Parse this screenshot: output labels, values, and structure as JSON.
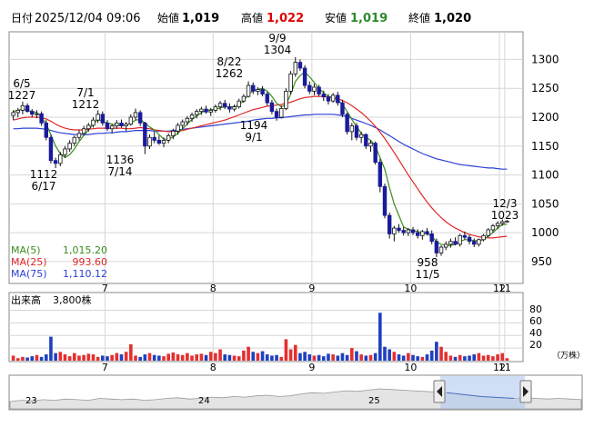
{
  "header": {
    "label_date": "日付",
    "date": "2025/12/04 09:06",
    "label_open": "始値",
    "open": "1,019",
    "label_high": "高値",
    "high": "1,022",
    "label_low": "安値",
    "low": "1,019",
    "label_close": "終値",
    "close": "1,020"
  },
  "colors": {
    "up": "#ffffff",
    "down": "#1a1a9c",
    "ma5": "#3c8c1e",
    "ma25": "#e22828",
    "ma75": "#2c3fd8",
    "high_value": "#e00000",
    "low_value": "#2a8a2a",
    "vol_bar": "#e43030",
    "vol_bar_down": "#2040c0",
    "nav_fill": "#a9c4ee",
    "frame": "#888888"
  },
  "legend": {
    "ma5_label": "MA(5)",
    "ma5_value": "1,015.20",
    "ma25_label": "MA(25)",
    "ma25_value": "993.60",
    "ma75_label": "MA(75)",
    "ma75_value": "1,110.12"
  },
  "volume_panel": {
    "label": "出来高",
    "value": "3,800株",
    "unit": "（万株）",
    "ticks": [
      "80",
      "60",
      "40",
      "20"
    ]
  },
  "navigator": {
    "year_labels": [
      "23",
      "24",
      "25"
    ]
  },
  "chart_data": {
    "type": "candlestick",
    "x_labels": [
      "7",
      "8",
      "9",
      "10",
      "11",
      "12"
    ],
    "y_ticks": [
      1300,
      1250,
      1200,
      1150,
      1100,
      1050,
      1000,
      950
    ],
    "ylim": [
      920,
      1340
    ],
    "annotations": [
      {
        "date": "6/5",
        "value": "1227"
      },
      {
        "date": "7/1",
        "value": "1212"
      },
      {
        "date": "6/17",
        "value": "1112"
      },
      {
        "date": "7/14",
        "value": "1136"
      },
      {
        "date": "8/22",
        "value": "1262"
      },
      {
        "date": "9/9",
        "value": "1304"
      },
      {
        "date": "9/1",
        "value": "1194"
      },
      {
        "date": "11/5",
        "value": "958"
      },
      {
        "date": "12/3",
        "value": "1023"
      }
    ],
    "candles": [
      [
        1203,
        1212,
        1195,
        1208
      ],
      [
        1208,
        1216,
        1200,
        1212
      ],
      [
        1212,
        1227,
        1205,
        1220
      ],
      [
        1220,
        1224,
        1208,
        1210
      ],
      [
        1210,
        1214,
        1200,
        1205
      ],
      [
        1205,
        1212,
        1198,
        1206
      ],
      [
        1206,
        1210,
        1185,
        1190
      ],
      [
        1190,
        1195,
        1160,
        1165
      ],
      [
        1165,
        1170,
        1120,
        1125
      ],
      [
        1125,
        1130,
        1112,
        1120
      ],
      [
        1120,
        1140,
        1115,
        1135
      ],
      [
        1135,
        1150,
        1130,
        1145
      ],
      [
        1145,
        1160,
        1140,
        1155
      ],
      [
        1155,
        1168,
        1150,
        1165
      ],
      [
        1165,
        1178,
        1160,
        1172
      ],
      [
        1172,
        1185,
        1168,
        1180
      ],
      [
        1180,
        1190,
        1175,
        1186
      ],
      [
        1186,
        1200,
        1182,
        1195
      ],
      [
        1195,
        1212,
        1190,
        1205
      ],
      [
        1205,
        1210,
        1185,
        1190
      ],
      [
        1190,
        1195,
        1176,
        1180
      ],
      [
        1180,
        1188,
        1172,
        1185
      ],
      [
        1185,
        1195,
        1180,
        1190
      ],
      [
        1190,
        1196,
        1182,
        1185
      ],
      [
        1185,
        1192,
        1176,
        1188
      ],
      [
        1188,
        1205,
        1185,
        1200
      ],
      [
        1200,
        1215,
        1195,
        1208
      ],
      [
        1208,
        1212,
        1185,
        1190
      ],
      [
        1190,
        1192,
        1136,
        1150
      ],
      [
        1150,
        1170,
        1145,
        1165
      ],
      [
        1165,
        1175,
        1155,
        1160
      ],
      [
        1160,
        1168,
        1152,
        1155
      ],
      [
        1155,
        1165,
        1148,
        1160
      ],
      [
        1160,
        1172,
        1155,
        1168
      ],
      [
        1168,
        1180,
        1162,
        1176
      ],
      [
        1176,
        1190,
        1170,
        1186
      ],
      [
        1186,
        1196,
        1180,
        1192
      ],
      [
        1192,
        1202,
        1186,
        1198
      ],
      [
        1198,
        1208,
        1192,
        1204
      ],
      [
        1204,
        1214,
        1198,
        1210
      ],
      [
        1210,
        1218,
        1204,
        1214
      ],
      [
        1214,
        1220,
        1206,
        1209
      ],
      [
        1209,
        1216,
        1202,
        1212
      ],
      [
        1212,
        1222,
        1208,
        1218
      ],
      [
        1218,
        1228,
        1212,
        1224
      ],
      [
        1224,
        1230,
        1214,
        1218
      ],
      [
        1218,
        1224,
        1208,
        1214
      ],
      [
        1214,
        1222,
        1210,
        1218
      ],
      [
        1218,
        1232,
        1215,
        1228
      ],
      [
        1228,
        1240,
        1225,
        1236
      ],
      [
        1236,
        1262,
        1234,
        1255
      ],
      [
        1255,
        1260,
        1240,
        1245
      ],
      [
        1245,
        1252,
        1238,
        1248
      ],
      [
        1248,
        1254,
        1236,
        1240
      ],
      [
        1240,
        1244,
        1220,
        1225
      ],
      [
        1225,
        1230,
        1205,
        1210
      ],
      [
        1210,
        1215,
        1194,
        1200
      ],
      [
        1200,
        1220,
        1198,
        1215
      ],
      [
        1215,
        1250,
        1212,
        1245
      ],
      [
        1245,
        1280,
        1240,
        1275
      ],
      [
        1275,
        1304,
        1270,
        1295
      ],
      [
        1295,
        1300,
        1280,
        1285
      ],
      [
        1285,
        1290,
        1250,
        1255
      ],
      [
        1255,
        1262,
        1240,
        1245
      ],
      [
        1245,
        1258,
        1238,
        1252
      ],
      [
        1252,
        1256,
        1236,
        1240
      ],
      [
        1240,
        1246,
        1228,
        1235
      ],
      [
        1235,
        1240,
        1222,
        1228
      ],
      [
        1228,
        1242,
        1225,
        1238
      ],
      [
        1238,
        1244,
        1220,
        1225
      ],
      [
        1225,
        1230,
        1200,
        1205
      ],
      [
        1205,
        1208,
        1170,
        1175
      ],
      [
        1175,
        1190,
        1160,
        1185
      ],
      [
        1185,
        1190,
        1160,
        1165
      ],
      [
        1165,
        1175,
        1155,
        1170
      ],
      [
        1170,
        1172,
        1145,
        1150
      ],
      [
        1150,
        1160,
        1140,
        1155
      ],
      [
        1155,
        1158,
        1118,
        1122
      ],
      [
        1122,
        1128,
        1070,
        1080
      ],
      [
        1080,
        1085,
        1025,
        1030
      ],
      [
        1030,
        1035,
        990,
        998
      ],
      [
        998,
        1012,
        985,
        1008
      ],
      [
        1008,
        1015,
        1000,
        1004
      ],
      [
        1004,
        1010,
        995,
        1000
      ],
      [
        1000,
        1008,
        994,
        1005
      ],
      [
        1005,
        1010,
        996,
        1000
      ],
      [
        1000,
        1006,
        990,
        995
      ],
      [
        995,
        1005,
        988,
        1002
      ],
      [
        1002,
        1008,
        995,
        998
      ],
      [
        998,
        1004,
        980,
        985
      ],
      [
        985,
        990,
        958,
        965
      ],
      [
        965,
        978,
        960,
        975
      ],
      [
        975,
        985,
        970,
        980
      ],
      [
        980,
        990,
        974,
        985
      ],
      [
        985,
        992,
        978,
        980
      ],
      [
        980,
        998,
        976,
        995
      ],
      [
        995,
        1002,
        988,
        992
      ],
      [
        992,
        996,
        980,
        985
      ],
      [
        985,
        990,
        975,
        980
      ],
      [
        980,
        990,
        976,
        988
      ],
      [
        988,
        998,
        985,
        995
      ],
      [
        995,
        1008,
        992,
        1005
      ],
      [
        1005,
        1015,
        1000,
        1012
      ],
      [
        1012,
        1020,
        1006,
        1016
      ],
      [
        1016,
        1023,
        1012,
        1019
      ],
      [
        1019,
        1022,
        1019,
        1020
      ]
    ],
    "volumes": [
      8,
      4,
      6,
      5,
      7,
      9,
      6,
      10,
      38,
      12,
      14,
      10,
      7,
      12,
      8,
      9,
      11,
      10,
      6,
      8,
      7,
      9,
      12,
      10,
      14,
      26,
      8,
      6,
      10,
      12,
      9,
      8,
      7,
      11,
      13,
      10,
      9,
      12,
      8,
      10,
      11,
      9,
      14,
      12,
      18,
      10,
      9,
      8,
      7,
      16,
      22,
      14,
      12,
      15,
      10,
      8,
      9,
      6,
      34,
      18,
      25,
      12,
      14,
      10,
      8,
      9,
      7,
      11,
      10,
      8,
      12,
      9,
      20,
      15,
      10,
      8,
      9,
      12,
      76,
      22,
      18,
      14,
      10,
      8,
      12,
      9,
      7,
      6,
      10,
      16,
      30,
      22,
      14,
      8,
      6,
      9,
      7,
      8,
      10,
      12,
      8,
      9,
      7,
      10,
      12,
      4
    ],
    "volume_up": [
      1,
      1,
      1,
      0,
      0,
      1,
      0,
      0,
      0,
      0,
      1,
      1,
      1,
      1,
      1,
      1,
      1,
      1,
      1,
      0,
      0,
      1,
      1,
      0,
      1,
      1,
      1,
      0,
      0,
      1,
      0,
      0,
      1,
      1,
      1,
      1,
      1,
      1,
      1,
      1,
      1,
      0,
      1,
      1,
      1,
      0,
      0,
      1,
      1,
      1,
      1,
      0,
      1,
      0,
      0,
      0,
      0,
      1,
      1,
      1,
      1,
      0,
      0,
      0,
      1,
      0,
      0,
      0,
      1,
      0,
      0,
      0,
      1,
      0,
      1,
      0,
      1,
      0,
      0,
      0,
      0,
      1,
      0,
      0,
      1,
      0,
      0,
      1,
      0,
      0,
      0,
      1,
      1,
      1,
      0,
      1,
      0,
      0,
      0,
      1,
      1,
      1,
      1,
      1,
      1,
      1
    ],
    "ma5": [
      1210,
      1212,
      1214,
      1212,
      1210,
      1208,
      1200,
      1188,
      1170,
      1150,
      1137,
      1130,
      1135,
      1145,
      1158,
      1168,
      1178,
      1188,
      1196,
      1193,
      1190,
      1188,
      1186,
      1186,
      1186,
      1190,
      1195,
      1196,
      1190,
      1183,
      1178,
      1170,
      1162,
      1162,
      1166,
      1172,
      1180,
      1188,
      1196,
      1202,
      1208,
      1212,
      1213,
      1214,
      1216,
      1218,
      1218,
      1218,
      1222,
      1228,
      1240,
      1246,
      1248,
      1250,
      1245,
      1236,
      1224,
      1218,
      1222,
      1240,
      1262,
      1272,
      1278,
      1270,
      1260,
      1250,
      1242,
      1236,
      1234,
      1230,
      1222,
      1210,
      1196,
      1184,
      1172,
      1165,
      1160,
      1150,
      1130,
      1110,
      1078,
      1050,
      1030,
      1010,
      1006,
      1004,
      1002,
      1000,
      998,
      994,
      984,
      980,
      978,
      978,
      980,
      985,
      988,
      988,
      986,
      986,
      988,
      994,
      1000,
      1008,
      1014,
      1015
    ],
    "ma25": [
      1195,
      1197,
      1199,
      1200,
      1200,
      1200,
      1199,
      1197,
      1193,
      1188,
      1184,
      1181,
      1179,
      1178,
      1178,
      1178,
      1179,
      1180,
      1181,
      1181,
      1181,
      1181,
      1181,
      1181,
      1180,
      1180,
      1181,
      1182,
      1181,
      1180,
      1178,
      1177,
      1176,
      1175,
      1175,
      1176,
      1177,
      1179,
      1181,
      1183,
      1185,
      1187,
      1189,
      1191,
      1193,
      1195,
      1198,
      1201,
      1204,
      1207,
      1210,
      1213,
      1215,
      1217,
      1219,
      1220,
      1221,
      1222,
      1224,
      1226,
      1229,
      1232,
      1234,
      1235,
      1236,
      1236,
      1236,
      1235,
      1234,
      1232,
      1229,
      1225,
      1220,
      1214,
      1208,
      1201,
      1193,
      1184,
      1174,
      1163,
      1151,
      1139,
      1126,
      1113,
      1100,
      1088,
      1076,
      1064,
      1053,
      1043,
      1034,
      1026,
      1019,
      1013,
      1008,
      1004,
      1000,
      997,
      995,
      993,
      992,
      991,
      991,
      992,
      993,
      994
    ],
    "ma75": [
      1180,
      1180,
      1181,
      1181,
      1181,
      1181,
      1180,
      1179,
      1177,
      1175,
      1173,
      1172,
      1171,
      1170,
      1170,
      1170,
      1170,
      1171,
      1172,
      1172,
      1173,
      1173,
      1174,
      1175,
      1175,
      1176,
      1177,
      1177,
      1177,
      1177,
      1176,
      1176,
      1176,
      1176,
      1177,
      1178,
      1179,
      1180,
      1181,
      1182,
      1183,
      1184,
      1185,
      1186,
      1187,
      1188,
      1189,
      1190,
      1191,
      1192,
      1193,
      1195,
      1196,
      1197,
      1198,
      1198,
      1199,
      1199,
      1200,
      1201,
      1202,
      1203,
      1204,
      1204,
      1205,
      1205,
      1205,
      1205,
      1205,
      1204,
      1203,
      1201,
      1198,
      1195,
      1192,
      1189,
      1186,
      1182,
      1178,
      1173,
      1168,
      1163,
      1158,
      1153,
      1149,
      1145,
      1141,
      1137,
      1134,
      1131,
      1128,
      1126,
      1124,
      1122,
      1120,
      1118,
      1117,
      1116,
      1115,
      1114,
      1113,
      1112,
      1112,
      1111,
      1110,
      1110
    ]
  }
}
